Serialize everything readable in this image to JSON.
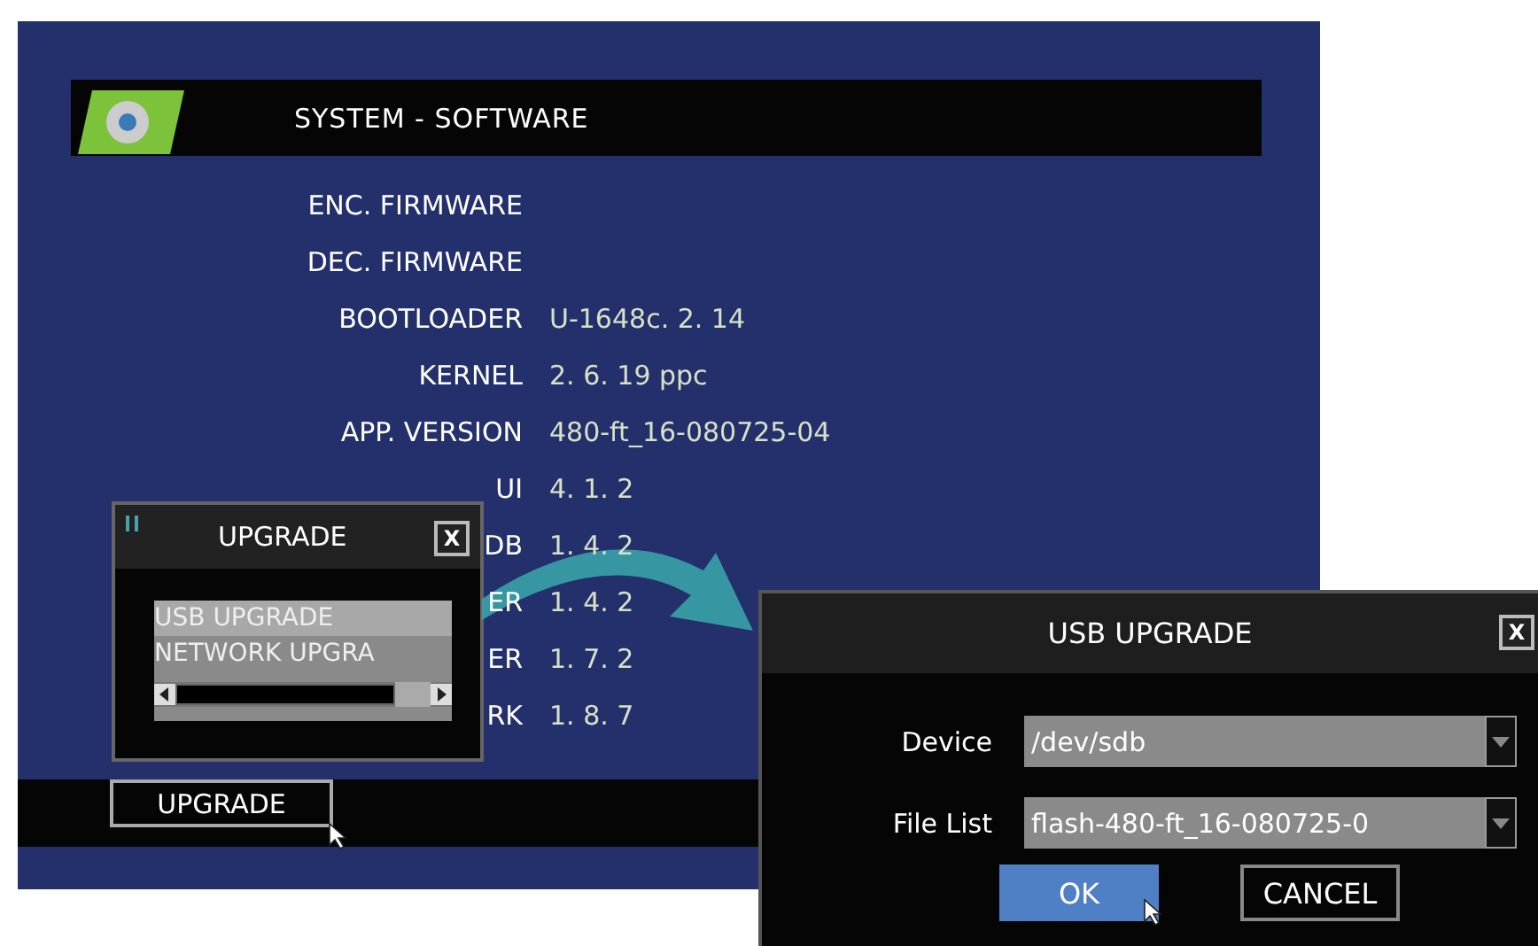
{
  "header": {
    "title": "SYSTEM - SOFTWARE"
  },
  "info_rows": [
    {
      "label": "ENC. FIRMWARE",
      "value": ""
    },
    {
      "label": "DEC. FIRMWARE",
      "value": ""
    },
    {
      "label": "BOOTLOADER",
      "value": "U-1648c. 2. 14"
    },
    {
      "label": "KERNEL",
      "value": "2. 6. 19 ppc"
    },
    {
      "label": "APP. VERSION",
      "value": "480-ft_16-080725-04"
    },
    {
      "label": "UI",
      "value": "4. 1. 2"
    },
    {
      "label": "DB",
      "value": "1. 4. 2"
    },
    {
      "label": "ER",
      "value": "1. 4. 2"
    },
    {
      "label": "ER",
      "value": "1. 7. 2"
    },
    {
      "label": "RK",
      "value": "1. 8. 7"
    }
  ],
  "bottom_button": {
    "label": "UPGRADE"
  },
  "upgrade_popup": {
    "title": "UPGRADE",
    "close": "X",
    "items": [
      {
        "label": "USB UPGRADE",
        "selected": true
      },
      {
        "label": "NETWORK UPGRA",
        "selected": false
      }
    ]
  },
  "usb_dialog": {
    "title": "USB UPGRADE",
    "close": "X",
    "fields": [
      {
        "label": "Device",
        "value": "/dev/sdb"
      },
      {
        "label": "File List",
        "value": "flash-480-ft_16-080725-0"
      }
    ],
    "buttons": [
      {
        "label": "OK",
        "selected": true
      },
      {
        "label": "CANCEL",
        "selected": false
      }
    ]
  }
}
